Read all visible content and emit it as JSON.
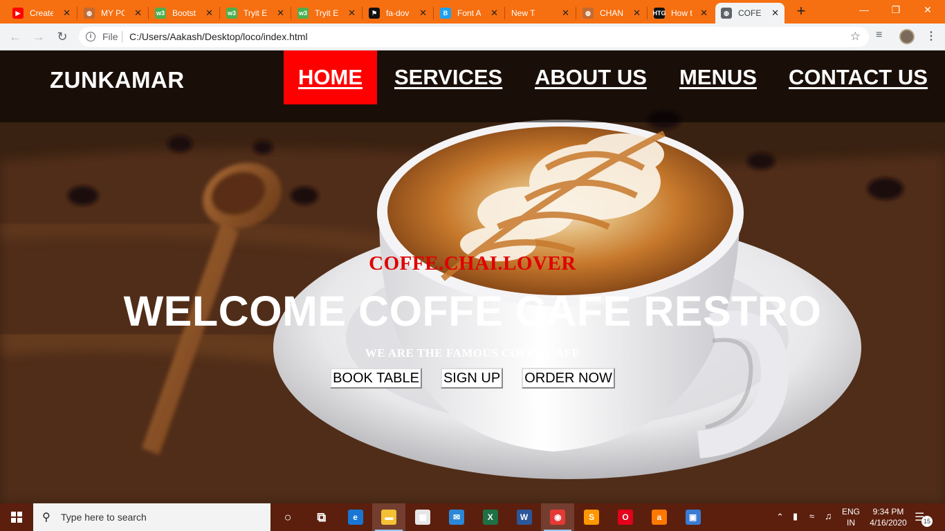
{
  "browser": {
    "tabs": [
      {
        "title": "Create",
        "favicon": "youtube-icon",
        "color": "#ff0000",
        "glyph": "▶"
      },
      {
        "title": "MY PC",
        "favicon": "globe-icon",
        "color": "#c26b34",
        "glyph": "◍"
      },
      {
        "title": "Bootst",
        "favicon": "w3schools-icon",
        "color": "#4caf50",
        "glyph": "w3"
      },
      {
        "title": "Tryit E",
        "favicon": "w3schools-icon",
        "color": "#4caf50",
        "glyph": "w3"
      },
      {
        "title": "Tryit E",
        "favicon": "w3schools-icon",
        "color": "#4caf50",
        "glyph": "w3"
      },
      {
        "title": "fa-dov",
        "favicon": "flag-icon",
        "color": "#111111",
        "glyph": "⚑"
      },
      {
        "title": "Font A",
        "favicon": "bootstrap-b-icon",
        "color": "#1da1f2",
        "glyph": "B"
      },
      {
        "title": "New Tab",
        "favicon": "",
        "color": "",
        "glyph": ""
      },
      {
        "title": "CHAN",
        "favicon": "globe-icon",
        "color": "#c26b34",
        "glyph": "◍"
      },
      {
        "title": "How t",
        "favicon": "htg-icon",
        "color": "#111111",
        "glyph": "HTG"
      },
      {
        "title": "COFEE",
        "favicon": "globe-icon",
        "color": "#5f6368",
        "glyph": "◍"
      }
    ],
    "address": {
      "scheme_label": "File",
      "url": "C:/Users/Aakash/Desktop/loco/index.html"
    },
    "new_tab_label": "+",
    "close_glyph": "✕"
  },
  "site": {
    "logo": "ZUNKAMAR",
    "nav": [
      {
        "label": "HOME",
        "active": true
      },
      {
        "label": "SERVICES",
        "active": false
      },
      {
        "label": "ABOUT US",
        "active": false
      },
      {
        "label": "MENUS",
        "active": false
      },
      {
        "label": "CONTACT US",
        "active": false
      }
    ],
    "hero": {
      "tagline": "COFFE.CHAI.LOVER",
      "headline": "WELCOME COFFE CAFE RESTRO",
      "subline": "WE ARE THE FAMOUS COFFE CAFE",
      "buttons": [
        "BOOK TABLE",
        "SIGN UP",
        "ORDER NOW"
      ]
    },
    "accent_color": "#ff0000"
  },
  "taskbar": {
    "search_placeholder": "Type here to search",
    "apps": [
      {
        "name": "cortana-icon",
        "glyph": "○",
        "color": ""
      },
      {
        "name": "task-view-icon",
        "glyph": "⧉",
        "color": ""
      },
      {
        "name": "edge-icon",
        "glyph": "e",
        "color": "#1877d4"
      },
      {
        "name": "file-explorer-icon",
        "glyph": "▬",
        "color": "#f4c034"
      },
      {
        "name": "store-icon",
        "glyph": "▦",
        "color": "#e6e6e6"
      },
      {
        "name": "mail-icon",
        "glyph": "✉",
        "color": "#2b88d8"
      },
      {
        "name": "excel-icon",
        "glyph": "X",
        "color": "#1e7145"
      },
      {
        "name": "word-icon",
        "glyph": "W",
        "color": "#2b579a"
      },
      {
        "name": "chrome-icon",
        "glyph": "◉",
        "color": "#e53935"
      },
      {
        "name": "sublime-icon",
        "glyph": "S",
        "color": "#ff9800"
      },
      {
        "name": "opera-icon",
        "glyph": "O",
        "color": "#e3001b"
      },
      {
        "name": "avast-icon",
        "glyph": "a",
        "color": "#ff7800"
      },
      {
        "name": "photos-icon",
        "glyph": "▣",
        "color": "#3a7bd5"
      }
    ],
    "language": [
      "ENG",
      "IN"
    ],
    "time": "9:34 PM",
    "date": "4/16/2020",
    "notification_count": "15"
  }
}
